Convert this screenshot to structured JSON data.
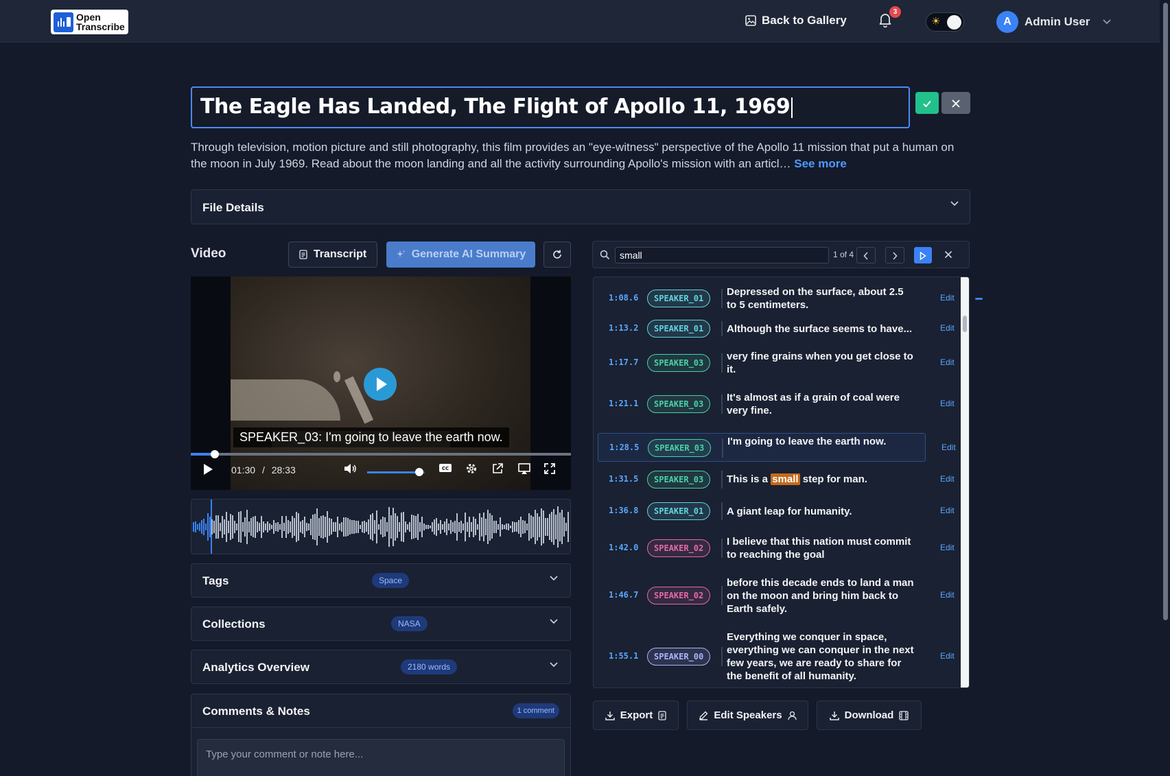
{
  "header": {
    "logo_line1": "Open",
    "logo_line2": "Transcribe",
    "back_label": "Back to Gallery",
    "notifications_count": "3",
    "user_name": "Admin User",
    "user_initial": "A"
  },
  "media": {
    "title": "The Eagle Has Landed, The Flight of Apollo 11, 1969",
    "description": "Through television, motion picture and still photography, this film provides an \"eye-witness\" perspective of the Apollo 11 mission that put a human on the moon in July 1969. Read about the moon landing and all the activity surrounding Apollo's mission with an articl…",
    "see_more": "See more",
    "file_details_label": "File Details"
  },
  "video_section": {
    "label": "Video",
    "transcript_btn": "Transcript",
    "summary_btn": "Generate AI Summary",
    "caption": "SPEAKER_03: I'm going to leave the earth now.",
    "current_time": "01:30",
    "separator": "/",
    "duration": "28:33",
    "progress_fraction": 0.063,
    "volume_fraction": 0.9
  },
  "panels": {
    "tags_label": "Tags",
    "tags_badge": "Space",
    "collections_label": "Collections",
    "collections_badge": "NASA",
    "analytics_label": "Analytics Overview",
    "analytics_badge": "2180 words",
    "comments_label": "Comments & Notes",
    "comments_badge": "1 comment",
    "comment_placeholder": "Type your comment or note here..."
  },
  "search": {
    "value": "small",
    "count": "1 of 4"
  },
  "transcript": [
    {
      "time": "1:08.6",
      "speaker": "SPEAKER_01",
      "text": "Depressed on the surface, about 2.5 to 5 centimeters.",
      "edit": "Edit"
    },
    {
      "time": "1:13.2",
      "speaker": "SPEAKER_01",
      "text": "Although the surface seems to have...",
      "edit": "Edit"
    },
    {
      "time": "1:17.7",
      "speaker": "SPEAKER_03",
      "text": "very fine grains when you get close to it.",
      "edit": "Edit"
    },
    {
      "time": "1:21.1",
      "speaker": "SPEAKER_03",
      "text": "It's almost as if a grain of coal were very fine.",
      "edit": "Edit"
    },
    {
      "time": "1:28.5",
      "speaker": "SPEAKER_03",
      "text": "I'm going to leave the earth now.",
      "edit": "Edit"
    },
    {
      "time": "1:31.5",
      "speaker": "SPEAKER_03",
      "text_before": "This is a",
      "text_highlight": "small",
      "text_after": "step for man.",
      "edit": "Edit"
    },
    {
      "time": "1:36.8",
      "speaker": "SPEAKER_01",
      "text": "A giant leap for humanity.",
      "edit": "Edit"
    },
    {
      "time": "1:42.0",
      "speaker": "SPEAKER_02",
      "text": "I believe that this nation must commit to reaching the goal",
      "edit": "Edit"
    },
    {
      "time": "1:46.7",
      "speaker": "SPEAKER_02",
      "text": "before this decade ends to land a man on the moon and bring him back to Earth safely.",
      "edit": "Edit"
    },
    {
      "time": "1:55.1",
      "speaker": "SPEAKER_00",
      "text": "Everything we conquer in space, everything we can conquer in the next few years, we are ready to share for the benefit of all humanity.",
      "edit": "Edit"
    }
  ],
  "actions": {
    "export": "Export",
    "edit_speakers": "Edit Speakers",
    "download": "Download"
  },
  "colors": {
    "accent": "#3b82f6",
    "speaker_01": "#5fd4e0",
    "speaker_03": "#4ad1a6",
    "speaker_02": "#e46aa7",
    "speaker_00": "#a9b4ff",
    "highlight": "#c46a1b"
  },
  "icons": {
    "back": "gallery-icon",
    "bell": "bell-icon",
    "theme": "sun-icon",
    "confirm": "check-icon",
    "cancel": "close-icon"
  }
}
